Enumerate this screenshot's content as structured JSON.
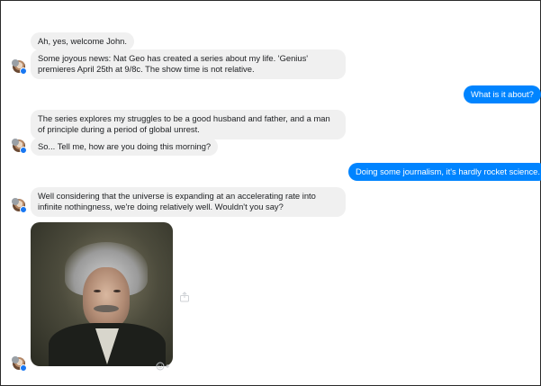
{
  "conversation": {
    "messages": [
      {
        "direction": "incoming",
        "text": "Ah, yes, welcome John."
      },
      {
        "direction": "incoming",
        "text": "Some joyous news: Nat Geo has created a series about my life. 'Genius' premieres April 25th at 9/8c. The show time is not relative."
      },
      {
        "direction": "outgoing",
        "text": "What is it about?"
      },
      {
        "direction": "incoming",
        "text": "The series explores my struggles to be a good husband and father, and a man of principle during a period of global unrest."
      },
      {
        "direction": "incoming",
        "text": "So... Tell me, how are you doing this morning?"
      },
      {
        "direction": "outgoing",
        "text": "Doing some journalism, it's hardly rocket science."
      },
      {
        "direction": "incoming",
        "text": "Well considering that the universe is expanding at an accelerating rate into infinite nothingness, we're doing relatively well. Wouldn't you say?"
      }
    ]
  },
  "colors": {
    "outgoing_bubble": "#0084ff",
    "incoming_bubble": "#f0f0f0",
    "online_dot": "#1877f2"
  },
  "icons": {
    "share": "share-icon",
    "react": "smiley-icon"
  }
}
